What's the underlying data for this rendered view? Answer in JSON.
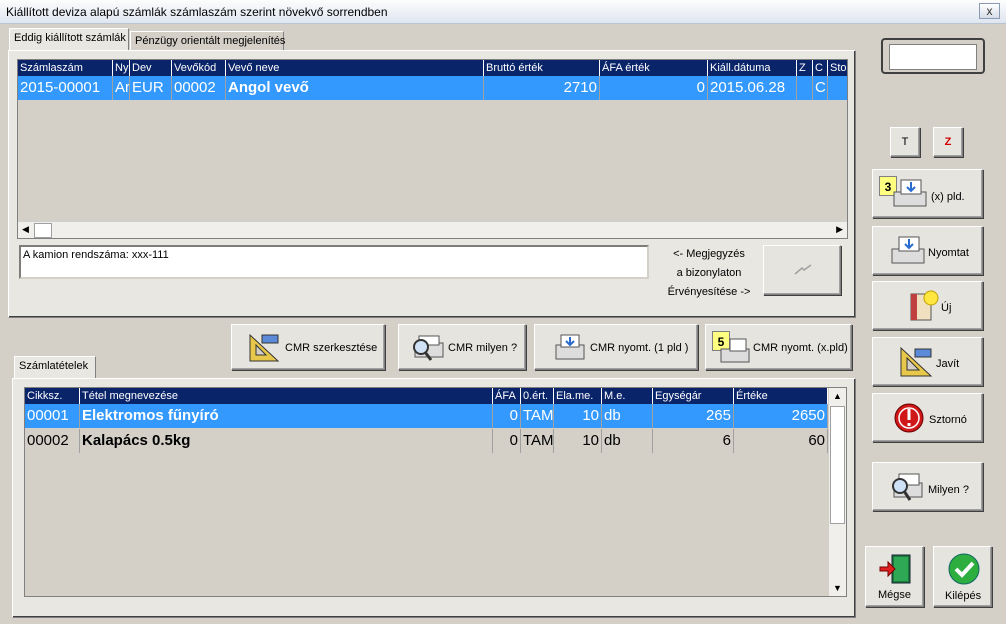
{
  "window": {
    "title": "Kiállított deviza alapú számlák számlaszám szerint növekvő sorrendben",
    "close": "x"
  },
  "tabs": {
    "tab1": "Eddig kiállított számlák",
    "tab2": "Pénzügy orientált megjelenítés"
  },
  "invoices": {
    "headers": [
      "Számlaszám",
      "Ny",
      "Dev",
      "Vevőkód",
      "Vevő neve",
      "Bruttó érték",
      "ÁFA érték",
      "Kiáll.dátuma",
      "Z",
      "C",
      "Sto"
    ],
    "rows": [
      [
        "2015-00001",
        "Ar",
        "EUR",
        "00002",
        "Angol vevő",
        "2710",
        "0",
        "2015.06.28",
        "",
        "C",
        ""
      ]
    ]
  },
  "note": {
    "text": "A kamion rendszáma: xxx-111",
    "caption": [
      "<- Megjegyzés",
      "a bizonylaton",
      "Érvényesítése ->"
    ]
  },
  "cmr": {
    "edit": "CMR szerkesztése",
    "what": "CMR milyen ?",
    "print1": "CMR nyomt. (1 pld )",
    "printx": "CMR nyomt. (x.pld)",
    "printx_count": "5"
  },
  "items_tab": "Számlatételek",
  "items": {
    "headers": [
      "Cikksz.",
      "Tétel megnevezése",
      "ÁFA",
      "0.ért.",
      "Ela.me.",
      "M.e.",
      "Egységár",
      "Értéke"
    ],
    "rows": [
      [
        "00001",
        "Elektromos fűnyíró",
        "0",
        "TAM",
        "10",
        "db",
        "265",
        "2650"
      ],
      [
        "00002",
        "Kalapács 0.5kg",
        "0",
        "TAM",
        "10",
        "db",
        "6",
        "60"
      ]
    ]
  },
  "right": {
    "t": "T",
    "z": "Z",
    "copies_count": "3",
    "copies": "(x) pld.",
    "print": "Nyomtat",
    "new": "Új",
    "fix": "Javít",
    "storno": "Sztornó",
    "what": "Milyen ?",
    "cancel": "Mégse",
    "exit": "Kilépés"
  },
  "colors": {
    "header_bg": "#0a246a",
    "selection": "#3399ff",
    "window_bg": "#d4d0c8"
  }
}
